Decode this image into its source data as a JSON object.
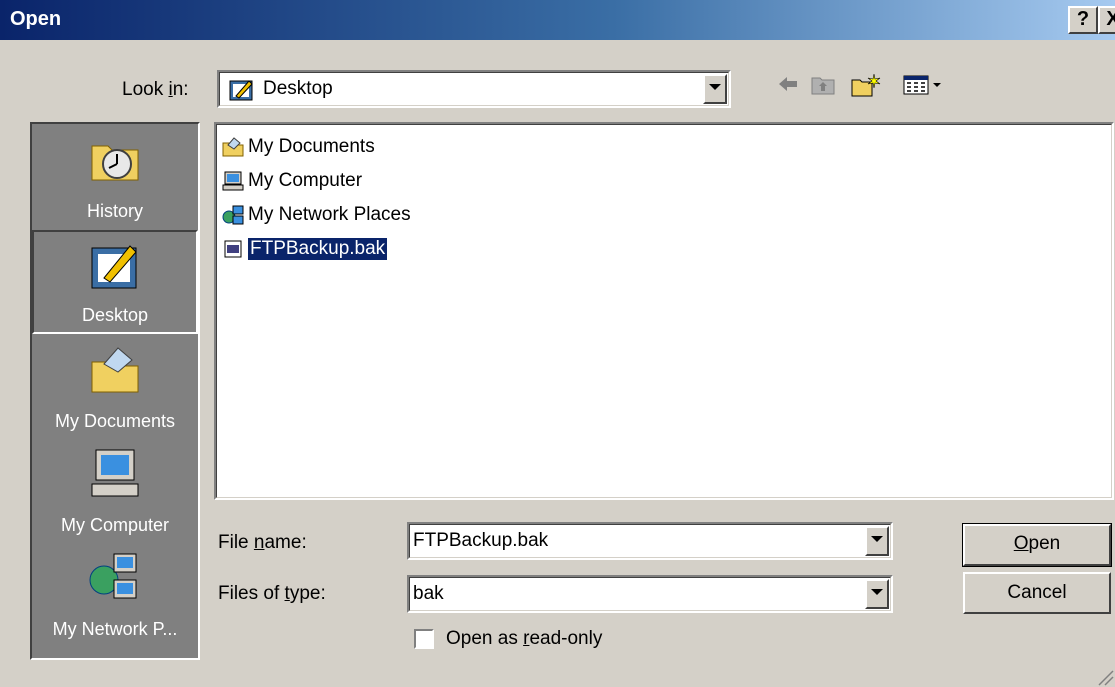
{
  "window": {
    "title": "Open",
    "help_button": "?",
    "close_button": "X"
  },
  "look_in": {
    "label_prefix": "Look ",
    "label_key": "i",
    "label_suffix": "n:",
    "value": "Desktop",
    "icon": "desktop-icon"
  },
  "toolbar": {
    "back": "back-arrow-icon",
    "up": "up-folder-icon",
    "new_folder": "new-folder-icon",
    "views": "view-menu-icon"
  },
  "places": [
    {
      "label": "History",
      "icon": "history-icon",
      "selected": false
    },
    {
      "label": "Desktop",
      "icon": "desktop-icon",
      "selected": true
    },
    {
      "label": "My Documents",
      "icon": "my-documents-icon",
      "selected": false
    },
    {
      "label": "My Computer",
      "icon": "my-computer-icon",
      "selected": false
    },
    {
      "label": "My Network P...",
      "icon": "network-places-icon",
      "selected": false
    }
  ],
  "files": [
    {
      "name": "My Documents",
      "icon": "my-documents-icon",
      "selected": false
    },
    {
      "name": "My Computer",
      "icon": "my-computer-icon",
      "selected": false
    },
    {
      "name": "My Network Places",
      "icon": "network-places-icon",
      "selected": false
    },
    {
      "name": "FTPBackup.bak",
      "icon": "bak-file-icon",
      "selected": true
    }
  ],
  "file_name": {
    "label_prefix": "File ",
    "label_key": "n",
    "label_suffix": "ame:",
    "value": "FTPBackup.bak"
  },
  "file_type": {
    "label_prefix": "Files of ",
    "label_key": "t",
    "label_suffix": "ype:",
    "value": "bak"
  },
  "read_only": {
    "label_prefix": "Open as ",
    "label_key": "r",
    "label_suffix": "ead-only",
    "checked": false
  },
  "buttons": {
    "open_key": "O",
    "open_rest": "pen",
    "cancel": "Cancel"
  },
  "colors": {
    "title_start": "#0a246a",
    "title_end": "#a6caf0",
    "selection": "#0a246a",
    "face": "#d4d0c8"
  }
}
